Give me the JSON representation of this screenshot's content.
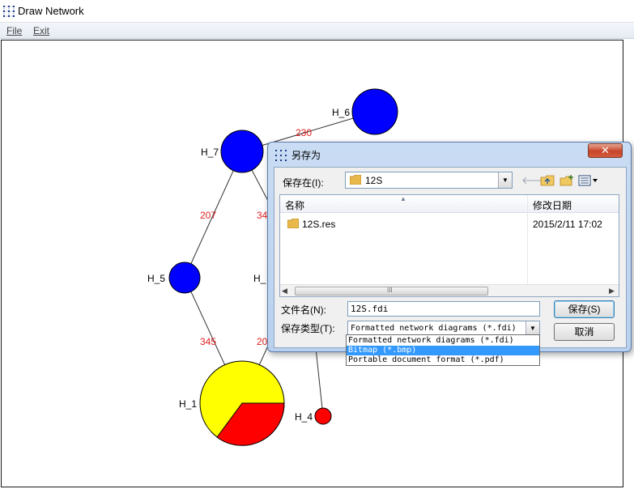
{
  "window": {
    "title": "Draw Network",
    "app_icon": "network-grid-icon"
  },
  "menu": {
    "file": "File",
    "exit": "Exit"
  },
  "network": {
    "nodes": [
      {
        "id": "H_1",
        "label": "H_1",
        "fill": "#ffff00",
        "pie": [
          {
            "fraction": 0.6,
            "color": "#ffff00"
          },
          {
            "fraction": 0.4,
            "color": "#ff0000"
          }
        ]
      },
      {
        "id": "H_4",
        "label": "H_4",
        "fill": "#ff0000"
      },
      {
        "id": "H_5",
        "label": "H_5",
        "fill": "#0000ff"
      },
      {
        "id": "H_6",
        "label": "H_6",
        "fill": "#0000ff"
      },
      {
        "id": "H_7",
        "label": "H_7",
        "fill": "#0000ff"
      },
      {
        "id": "H_hidden",
        "label": "H_",
        "fill": "#0000ff"
      }
    ],
    "edge_labels": {
      "h7_h6": "230",
      "h7_h5": "207",
      "h7_hidden": "34",
      "h5_h1": "345",
      "h1_hidden": "20"
    },
    "colors": {
      "edge_label": "#e02020",
      "node_blue": "#0000ff",
      "node_red": "#ff0000",
      "node_yellow": "#ffff00"
    }
  },
  "dialog": {
    "title": "另存为",
    "close_label": "✕",
    "look_in_label": "保存在(I):",
    "look_in_value": "12S",
    "toolbar_icons": [
      "back-arrow-icon",
      "up-folder-icon",
      "new-folder-icon",
      "view-menu-icon"
    ],
    "columns": {
      "name": "名称",
      "date": "修改日期"
    },
    "files": [
      {
        "name": "12S.res",
        "date": "2015/2/11 17:02"
      }
    ],
    "scroll_grip": "III",
    "file_name_label": "文件名(N):",
    "file_name_value": "12S.fdi",
    "file_type_label": "保存类型(T):",
    "file_type_value": "Formatted network diagrams (*.fdi)",
    "save_button": "保存(S)",
    "cancel_button": "取消",
    "file_type_options": [
      "Formatted network diagrams (*.fdi)",
      "Bitmap (*.bmp)",
      "Portable document format (*.pdf)"
    ],
    "selected_option_index": 1
  }
}
